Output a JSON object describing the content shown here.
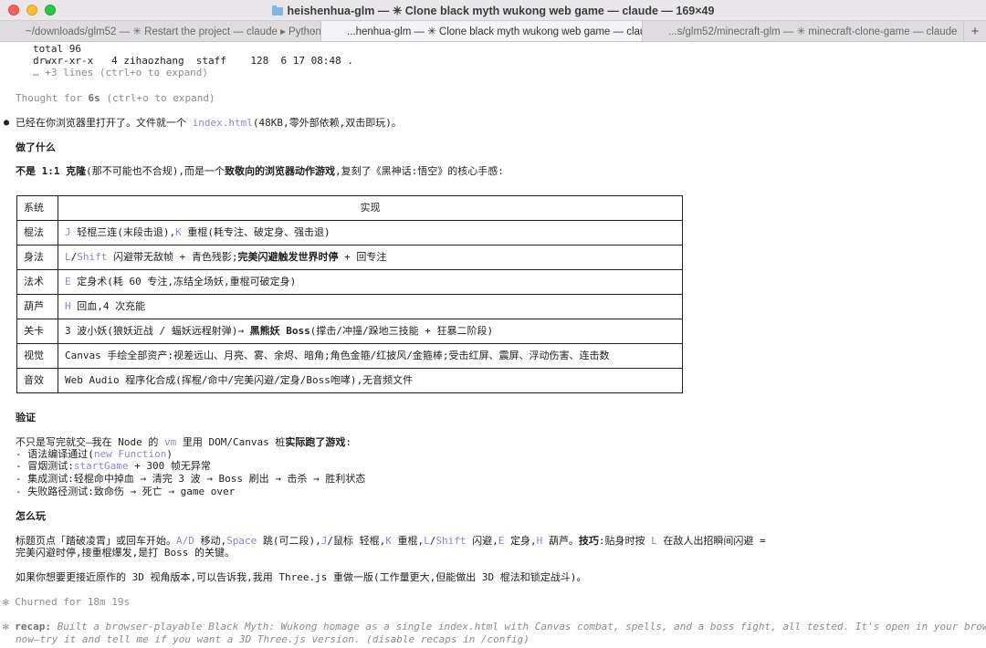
{
  "window": {
    "title": "heishenhua-glm — ✳ Clone black myth wukong web game — claude — 169×49"
  },
  "tabs": [
    {
      "label": "~/downloads/glm52 — ✳ Restart the project — claude ▸ Python",
      "more": "...",
      "active": false
    },
    {
      "label": "...henhua-glm — ✳ Clone black myth wukong web game — claude",
      "more": "",
      "active": true
    },
    {
      "label": "...s/glm52/minecraft-glm — ✳ minecraft-clone-game — claude",
      "more": "...",
      "active": false
    }
  ],
  "tab_plus": "+",
  "terminal": {
    "ls1": "total 96",
    "ls2": "drwxr-xr-x   4 zihaozhang  staff    128  6 17 08:48 .",
    "ls_more": "… +3 lines (ctrl+o to expand)",
    "thought_pre": "Thought for ",
    "thought_time": "6s",
    "thought_post": " (ctrl+o to expand)",
    "bullet": "●",
    "intro_pre": "已经在你浏览器里打开了。文件就一个 ",
    "intro_file": "index.html",
    "intro_post": "(48KB,零外部依赖,双击即玩)。",
    "h_done": "做了什么",
    "p_not_b1": "不是 1:1 克隆",
    "p_not_1": "(那不可能也不合规),而是一个",
    "p_not_b2": "致敬向的浏览器动作游戏",
    "p_not_2": ",复刻了《黑神话:悟空》的核心手感:",
    "table": {
      "head": [
        "系统",
        "实现"
      ],
      "rows": [
        {
          "sys": "棍法",
          "k1": "J",
          "t1": " 轻棍三连(末段击退),",
          "k2": "K",
          "t2": " 重棍(耗专注、破定身、强击退)"
        },
        {
          "sys": "身法",
          "k1": "L",
          "t0": "/",
          "k2": "Shift",
          "t1": " 闪避带无敌帧 + 青色残影;",
          "b": "完美闪避触发世界时停",
          "t2": " + 回专注"
        },
        {
          "sys": "法术",
          "k1": "E",
          "t1": " 定身术(耗 60 专注,冻结全场妖,重棍可破定身)"
        },
        {
          "sys": "葫芦",
          "k1": "H",
          "t1": " 回血,4 次充能"
        },
        {
          "sys": "关卡",
          "t1": "3 波小妖(狼妖近战 / 蝠妖远程射弹)→ ",
          "b": "黑熊妖 Boss",
          "t2": "(撑击/冲撞/跺地三技能 + 狂暴二阶段)"
        },
        {
          "sys": "视觉",
          "t1": "Canvas 手绘全部资产:视差远山、月亮、雾、余烬、暗角;角色金箍/红披风/金箍棒;受击红屏、震屏、浮动伤害、连击数"
        },
        {
          "sys": "音效",
          "t1": "Web Audio 程序化合成(挥棍/命中/完美闪避/定身/Boss咆哮),无音频文件"
        }
      ]
    },
    "h_verify": "验证",
    "v_pre": "不只是写完就交—我在 Node 的 ",
    "v_vm": "vm",
    "v_mid": " 里用 DOM/Canvas 桩",
    "v_b": "实际跑了游戏",
    "v_post": ":",
    "v1_pre": "- 语法编译通过(",
    "v1_k": "new Function",
    "v1_post": ")",
    "v2_pre": "- 冒烟测试:",
    "v2_k": "startGame",
    "v2_post": " + 300 帧无异常",
    "v3": "- 集成测试:轻棍命中掉血 → 清完 3 波 → Boss 刷出 → 击杀 → 胜利状态",
    "v4": "- 失败路径测试:致命伤 → 死亡 → game over",
    "h_play": "怎么玩",
    "play": {
      "s1": "标题页点「踏破凌霄」或回车开始。",
      "k1": "A/D",
      "s2": " 移动,",
      "k2": "Space",
      "s3": " 跳(可二段),",
      "k3": "J",
      "s4": "/鼠标 轻棍,",
      "k4": "K",
      "s5": " 重棍,",
      "k5": "L",
      "s6": "/",
      "k6": "Shift",
      "s7": " 闪避,",
      "k7": "E",
      "s8": " 定身,",
      "k8": "H",
      "s9": " 葫芦。",
      "b": "技巧",
      "s10": ":贴身时按 ",
      "k9": "L",
      "s11": " 在敌人出招瞬间闪避 =",
      "line2": "完美闪避时停,接重棍爆发,是打 Boss 的关键。"
    },
    "threejs": "如果你想要更接近原作的 3D 视角版本,可以告诉我,我用 Three.js 重做一版(工作量更大,但能做出 3D 棍法和锁定战斗)。",
    "churn_star": "✻",
    "churn": " Churned for 18m 19s",
    "recap_star": "✻",
    "recap_label": " recap:",
    "recap_1": " Built a browser-playable Black Myth: Wukong homage as a single index.html with Canvas combat, spells, and a boss fight, all tested. It's open in your browser",
    "recap_2": "now—try it and tell me if you want a 3D Three.js version. (disable recaps in /config)"
  }
}
